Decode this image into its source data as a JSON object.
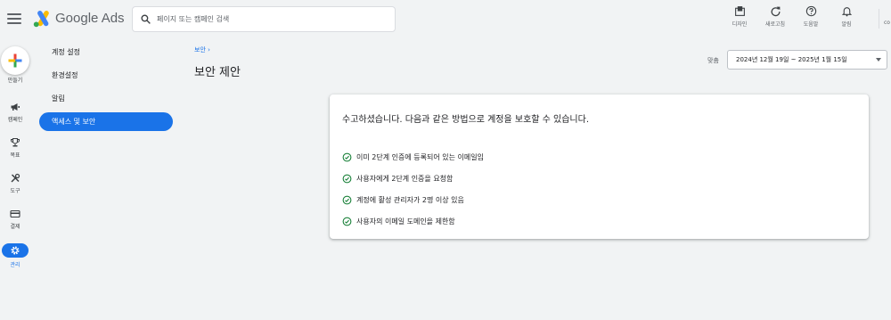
{
  "app": {
    "title": "Google Ads"
  },
  "search": {
    "placeholder": "페이지 또는 캠페인 검색"
  },
  "top_actions": [
    {
      "label": "디자인",
      "icon": "design-icon"
    },
    {
      "label": "새로고침",
      "icon": "refresh-icon"
    },
    {
      "label": "도움말",
      "icon": "help-icon"
    },
    {
      "label": "알림",
      "icon": "bell-icon"
    }
  ],
  "top_truncated": "co",
  "rail": {
    "create_label": "만들기",
    "items": [
      {
        "label": "캠페인",
        "icon": "megaphone-icon"
      },
      {
        "label": "목표",
        "icon": "trophy-icon"
      },
      {
        "label": "도구",
        "icon": "tools-icon"
      },
      {
        "label": "결제",
        "icon": "credit-card-icon"
      },
      {
        "label": "관리",
        "icon": "gear-icon",
        "active": true
      }
    ]
  },
  "sidenav": {
    "items": [
      {
        "label": "계정 설정"
      },
      {
        "label": "환경설정"
      },
      {
        "label": "알림"
      },
      {
        "label": "액세스 및 보안",
        "active": true
      }
    ]
  },
  "breadcrumb": {
    "label": "보안 ›"
  },
  "page": {
    "title": "보안 제안"
  },
  "date": {
    "label": "맞춤",
    "range": "2024년 12월 19일 ~ 2025년 1월 15일"
  },
  "card": {
    "heading": "수고하셨습니다. 다음과 같은 방법으로 계정을 보호할 수 있습니다.",
    "items": [
      {
        "text": "이미 2단계 인증에 등록되어 있는 이메일임"
      },
      {
        "text": "사용자에게 2단계 인증을 요청함"
      },
      {
        "text": "계정에 활성 관리자가 2명 이상 있음"
      },
      {
        "text": "사용자의 이메일 도메인을 제한함"
      }
    ]
  },
  "colors": {
    "accent": "#1a73e8",
    "success": "#188038",
    "background": "#f1f3f4"
  }
}
